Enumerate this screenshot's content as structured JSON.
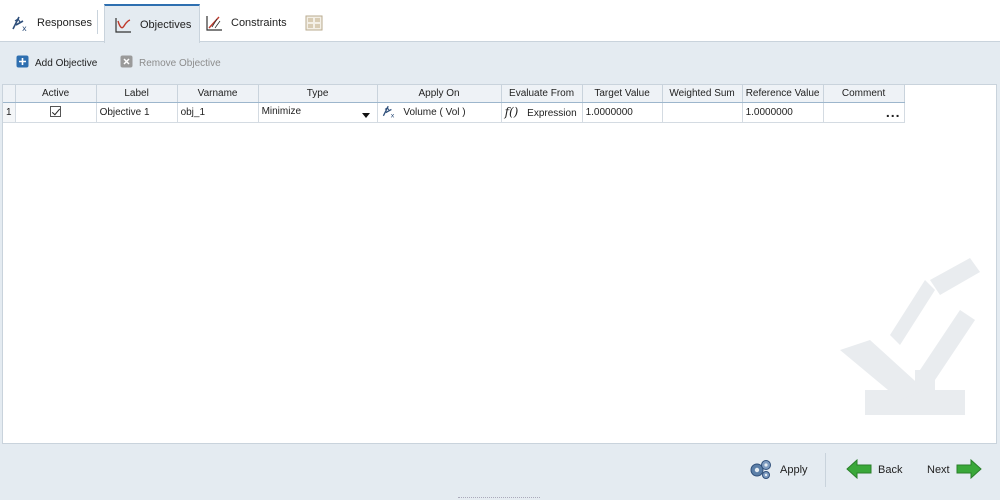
{
  "tabs": [
    {
      "label": "Responses",
      "icon": "response-variable-icon"
    },
    {
      "label": "Objectives",
      "icon": "objective-chart-icon",
      "active": true
    },
    {
      "label": "Constraints",
      "icon": "constraint-chart-icon"
    },
    {
      "label": "",
      "icon": "grid-view-icon"
    }
  ],
  "toolbar": {
    "add_label": "Add Objective",
    "remove_label": "Remove Objective"
  },
  "table": {
    "columns": [
      "Active",
      "Label",
      "Varname",
      "Type",
      "Apply On",
      "Evaluate From",
      "Target Value",
      "Weighted Sum",
      "Reference Value",
      "Comment"
    ],
    "rows": [
      {
        "num": "1",
        "active": true,
        "label": "Objective 1",
        "varname": "obj_1",
        "type": "Minimize",
        "apply_on": "Volume ( Vol )",
        "evaluate_fn": "f()",
        "evaluate_from": "Expression",
        "target_value": "1.0000000",
        "weighted_sum": "",
        "reference_value": "1.0000000",
        "comment": "..."
      }
    ]
  },
  "bottom": {
    "apply_label": "Apply",
    "back_label": "Back",
    "next_label": "Next"
  },
  "colors": {
    "accent": "#2e6fb0",
    "arrow_green": "#3aa83a",
    "background": "#e4ebf1"
  }
}
